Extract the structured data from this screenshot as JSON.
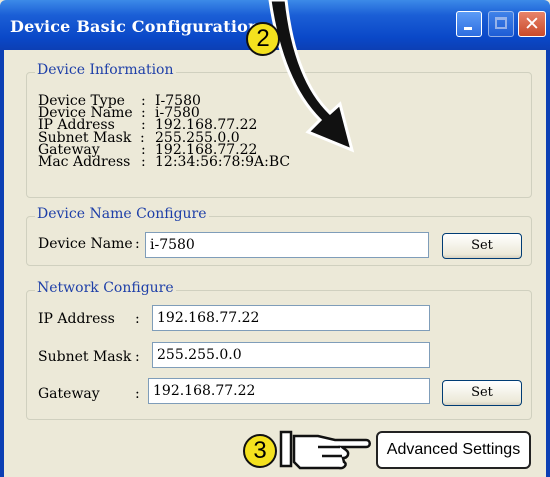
{
  "window": {
    "title": "Device Basic Configuration",
    "buttons": {
      "minimize": "minimize-icon",
      "maximize": "maximize-icon",
      "close": "close-icon"
    }
  },
  "device_info": {
    "group_title": "Device Information",
    "rows": [
      {
        "label": "Device Type",
        "value": "I-7580"
      },
      {
        "label": "Device Name",
        "value": "i-7580"
      },
      {
        "label": "IP Address",
        "value": "192.168.77.22"
      },
      {
        "label": "Subnet Mask",
        "value": "255.255.0.0"
      },
      {
        "label": "Gateway",
        "value": "192.168.77.22"
      },
      {
        "label": "Mac Address",
        "value": "12:34:56:78:9A:BC"
      }
    ],
    "separator": ":"
  },
  "name_config": {
    "group_title": "Device Name Configure",
    "label": "Device Name",
    "value": "i-7580",
    "set_label": "Set"
  },
  "network_config": {
    "group_title": "Network Configure",
    "ip_label": "IP Address",
    "ip_value": "192.168.77.22",
    "mask_label": "Subnet Mask",
    "mask_value": "255.255.0.0",
    "gateway_label": "Gateway",
    "gateway_value": "192.168.77.22",
    "set_label": "Set"
  },
  "advanced_button": "Advanced Settings",
  "annotations": {
    "step2": "2",
    "step3": "3",
    "step_color": "#f4e11e"
  }
}
